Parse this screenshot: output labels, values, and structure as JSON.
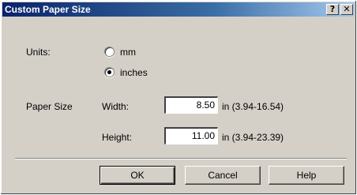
{
  "window": {
    "title": "Custom Paper Size",
    "help_button": "?",
    "close_button": "✕"
  },
  "units": {
    "label": "Units:",
    "options": [
      {
        "label": "mm",
        "selected": false
      },
      {
        "label": "inches",
        "selected": true
      }
    ]
  },
  "paper_size": {
    "label": "Paper Size",
    "width": {
      "label": "Width:",
      "value": "8.50",
      "range": "in (3.94-16.54)"
    },
    "height": {
      "label": "Height:",
      "value": "11.00",
      "range": "in (3.94-23.39)"
    }
  },
  "buttons": {
    "ok": "OK",
    "cancel": "Cancel",
    "help": "Help"
  },
  "colors": {
    "dialog_face": "#d4d0c8",
    "title_active_start": "#0a246a",
    "title_active_end": "#a6caf0"
  }
}
